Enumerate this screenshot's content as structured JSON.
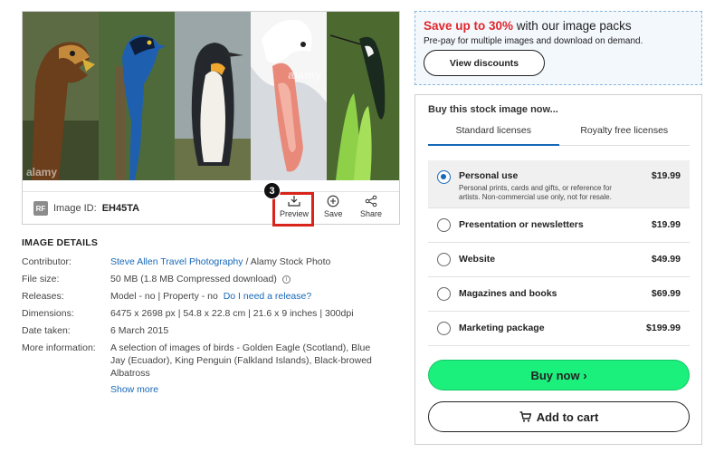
{
  "image": {
    "watermark": "alamy",
    "rf_badge": "RF",
    "id_label": "Image ID:",
    "id_value": "EH45TA",
    "step_number": "3",
    "actions": {
      "preview": "Preview",
      "save": "Save",
      "share": "Share"
    },
    "panels": [
      "golden-eagle",
      "blue-jay",
      "king-penguin",
      "albatross",
      "hummingbird"
    ]
  },
  "details": {
    "heading": "IMAGE DETAILS",
    "contributor": {
      "label": "Contributor:",
      "link": "Steve Allen Travel Photography",
      "suffix": "/ Alamy Stock Photo"
    },
    "file_size": {
      "label": "File size:",
      "value": "50 MB (1.8 MB Compressed download)"
    },
    "releases": {
      "label": "Releases:",
      "value": "Model - no | Property - no",
      "link": "Do I need a release?"
    },
    "dimensions": {
      "label": "Dimensions:",
      "value": "6475 x 2698 px | 54.8 x 22.8 cm | 21.6 x 9 inches | 300dpi"
    },
    "date_taken": {
      "label": "Date taken:",
      "value": "6 March 2015"
    },
    "more_info": {
      "label": "More information:",
      "value": "A selection of images of birds - Golden Eagle (Scotland), Blue Jay (Ecuador), King Penguin (Falkland Islands), Black-browed Albatross"
    },
    "show_more": "Show more"
  },
  "promo": {
    "highlight": "Save up to 30%",
    "rest": " with our image packs",
    "subtitle": "Pre-pay for multiple images and download on demand.",
    "button": "View discounts"
  },
  "buy": {
    "title": "Buy this stock image now...",
    "tabs": [
      {
        "label": "Standard licenses",
        "active": true
      },
      {
        "label": "Royalty free licenses",
        "active": false
      }
    ],
    "options": [
      {
        "name": "Personal use",
        "price": "$19.99",
        "selected": true,
        "description": "Personal prints, cards and gifts, or reference for artists. Non-commercial use only, not for resale."
      },
      {
        "name": "Presentation or newsletters",
        "price": "$19.99",
        "selected": false
      },
      {
        "name": "Website",
        "price": "$49.99",
        "selected": false
      },
      {
        "name": "Magazines and books",
        "price": "$69.99",
        "selected": false
      },
      {
        "name": "Marketing package",
        "price": "$199.99",
        "selected": false
      }
    ],
    "buy_now": "Buy now ›",
    "add_to_cart": "Add to cart"
  },
  "colors": {
    "accent_blue": "#1768b8",
    "promo_red": "#e0262c",
    "buy_green": "#1bf07d",
    "highlight_red": "#d9241b"
  }
}
